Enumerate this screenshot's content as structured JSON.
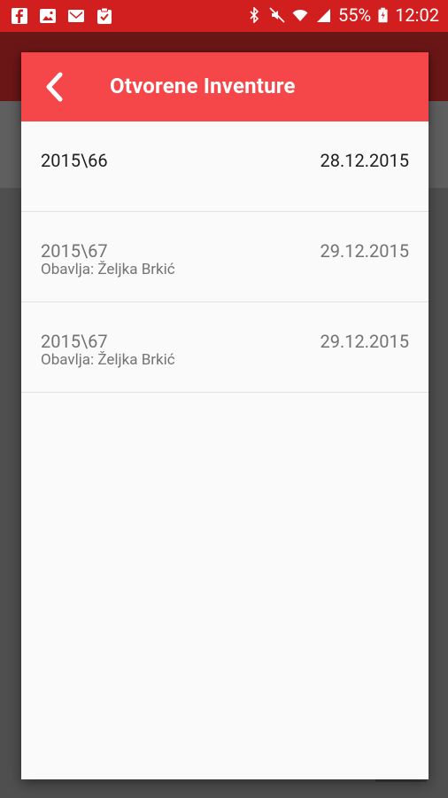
{
  "status_bar": {
    "battery": "55%",
    "time": "12:02",
    "left_icons": [
      "facebook-icon",
      "gallery-icon",
      "gmail-icon",
      "clipboard-check-icon"
    ],
    "right_icons": [
      "bluetooth-icon",
      "mute-icon",
      "wifi-icon",
      "signal-icon",
      "battery-icon"
    ]
  },
  "dialog": {
    "title": "Otvorene Inventure",
    "back_icon": "chevron-left-icon",
    "items": [
      {
        "number": "2015\\66",
        "date": "28.12.2015",
        "subtitle": ""
      },
      {
        "number": "2015\\67",
        "date": "29.12.2015",
        "subtitle": "Obavlja: Željka Brkić"
      },
      {
        "number": "2015\\67",
        "date": "29.12.2015",
        "subtitle": "Obavlja: Željka Brkić"
      }
    ]
  },
  "colors": {
    "status_bar": "#d11f1f",
    "dialog_header": "#f5474a",
    "dim_background": "#4f4f4f"
  }
}
